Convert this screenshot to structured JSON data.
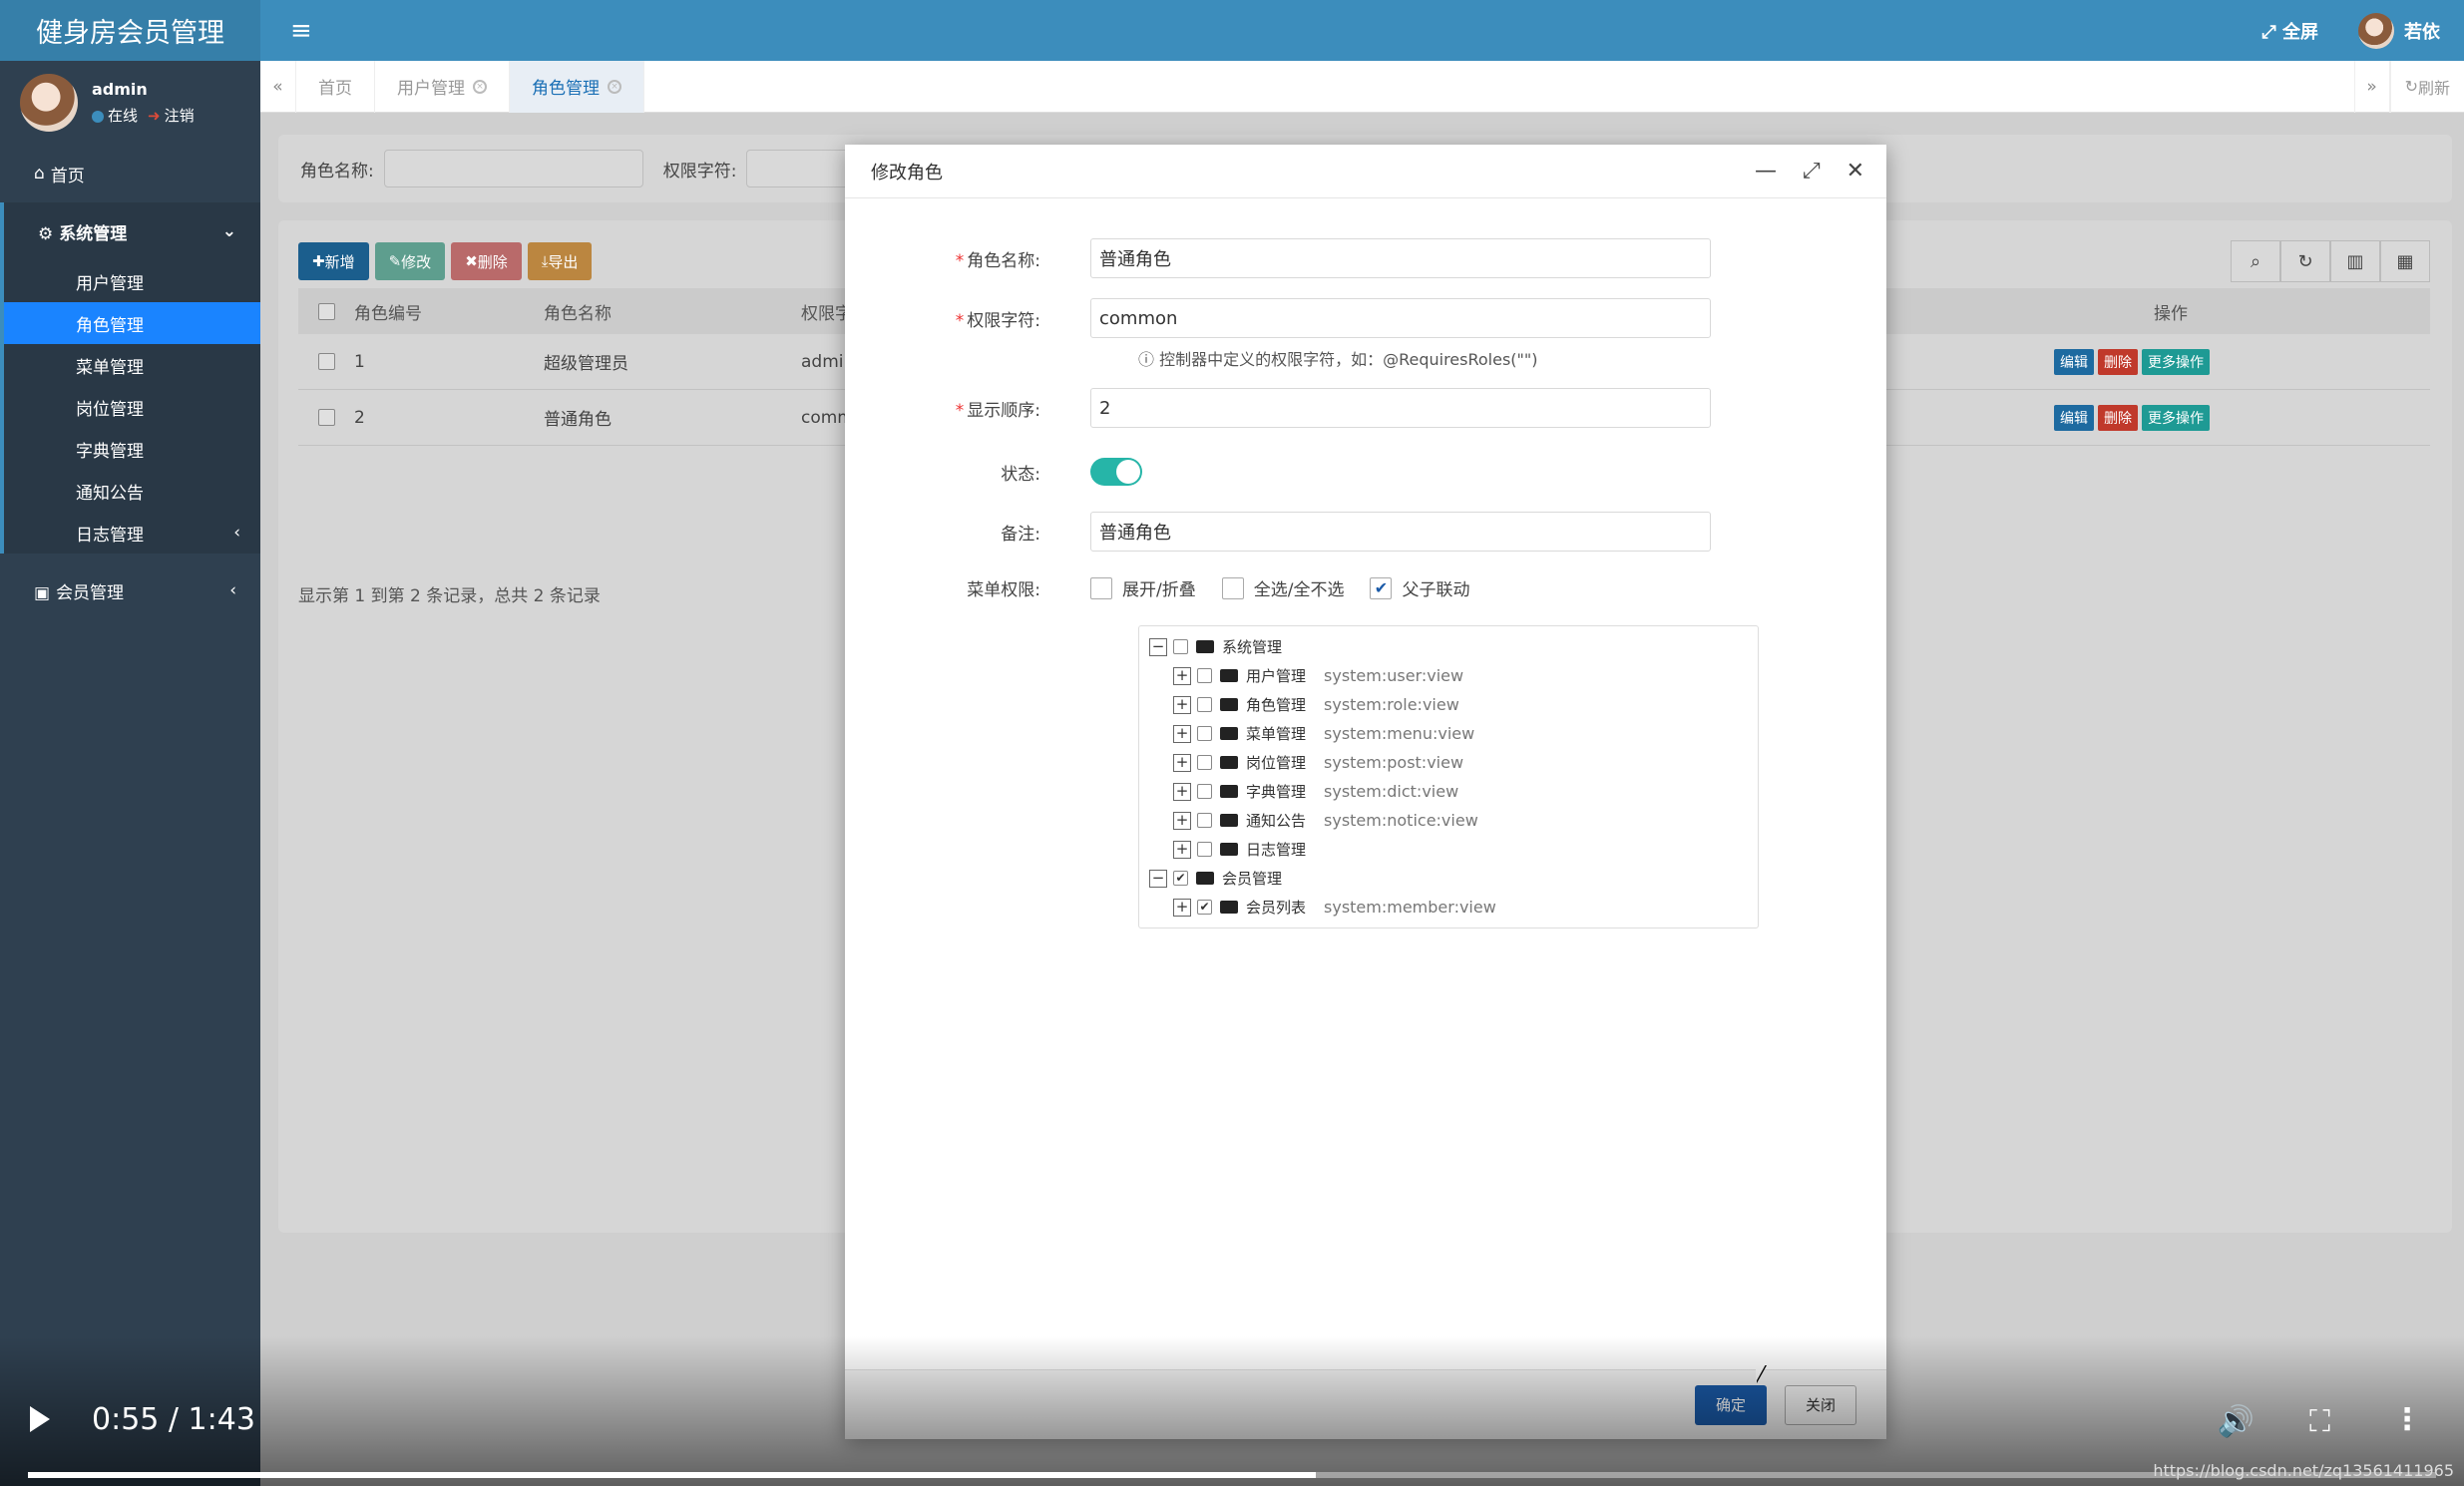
{
  "app": {
    "title": "健身房会员管理"
  },
  "user": {
    "name": "admin",
    "status": "在线",
    "logout": "注销",
    "top_name": "若依",
    "fullscreen": "全屏"
  },
  "sidebar": {
    "home": "首页",
    "system": "系统管理",
    "items": [
      "用户管理",
      "角色管理",
      "菜单管理",
      "岗位管理",
      "字典管理",
      "通知公告",
      "日志管理"
    ],
    "member": "会员管理"
  },
  "tabs": {
    "items": [
      "首页",
      "用户管理",
      "角色管理"
    ],
    "refresh": "刷新"
  },
  "search": {
    "role_name_label": "角色名称:",
    "perm_label": "权限字符:"
  },
  "toolbar": {
    "add": "新增",
    "edit": "修改",
    "delete": "删除",
    "export": "导出"
  },
  "table": {
    "headers": [
      "角色编号",
      "角色名称",
      "权限字",
      "操作"
    ],
    "rows": [
      {
        "id": "1",
        "name": "超级管理员",
        "key": "admi"
      },
      {
        "id": "2",
        "name": "普通角色",
        "key": "comm"
      }
    ],
    "row_actions": {
      "edit": "编辑",
      "delete": "删除",
      "more": "更多操作"
    },
    "page_info": "显示第 1 到第 2 条记录，总共 2 条记录"
  },
  "modal": {
    "title": "修改角色",
    "role_name_label": "角色名称:",
    "role_name_value": "普通角色",
    "perm_label": "权限字符:",
    "perm_value": "common",
    "perm_help": "控制器中定义的权限字符，如：@RequiresRoles(\"\")",
    "order_label": "显示顺序:",
    "order_value": "2",
    "status_label": "状态:",
    "remark_label": "备注:",
    "remark_value": "普通角色",
    "menu_label": "菜单权限:",
    "opt_expand": "展开/折叠",
    "opt_all": "全选/全不选",
    "opt_link": "父子联动",
    "tree": [
      {
        "label": "系统管理",
        "perm": "",
        "level": 0,
        "checked": false,
        "open": true
      },
      {
        "label": "用户管理",
        "perm": "system:user:view",
        "level": 1,
        "checked": false
      },
      {
        "label": "角色管理",
        "perm": "system:role:view",
        "level": 1,
        "checked": false
      },
      {
        "label": "菜单管理",
        "perm": "system:menu:view",
        "level": 1,
        "checked": false
      },
      {
        "label": "岗位管理",
        "perm": "system:post:view",
        "level": 1,
        "checked": false
      },
      {
        "label": "字典管理",
        "perm": "system:dict:view",
        "level": 1,
        "checked": false
      },
      {
        "label": "通知公告",
        "perm": "system:notice:view",
        "level": 1,
        "checked": false
      },
      {
        "label": "日志管理",
        "perm": "",
        "level": 1,
        "checked": false
      },
      {
        "label": "会员管理",
        "perm": "",
        "level": 0,
        "checked": true,
        "open": true
      },
      {
        "label": "会员列表",
        "perm": "system:member:view",
        "level": 1,
        "checked": true
      }
    ],
    "ok": "确定",
    "close": "关闭"
  },
  "video": {
    "time": "0:55 / 1:43",
    "progress": 0.535,
    "watermark": "https://blog.csdn.net/zq13561411965"
  },
  "colors": {
    "sidebar": "#2f4050",
    "header": "#3c8dbc",
    "active": "#1a84ff",
    "primary": "#1a5aa8"
  }
}
